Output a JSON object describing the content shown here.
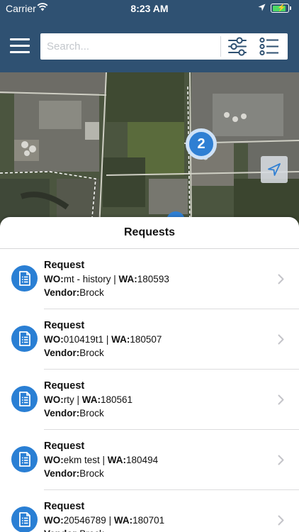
{
  "status_bar": {
    "carrier": "Carrier",
    "time": "8:23 AM",
    "battery_level": 0.9
  },
  "toolbar": {
    "search_placeholder": "Search...",
    "menu_icon": "hamburger-menu-icon",
    "filter_icon": "filter-sliders-icon",
    "list_icon": "list-view-icon"
  },
  "map": {
    "cluster_count": "2",
    "locate_icon": "navigation-arrow-icon",
    "add_icon": "add-location-pin-icon"
  },
  "sheet": {
    "title": "Requests"
  },
  "requests": [
    {
      "title": "Request",
      "wo_label": "WO:",
      "wo": "mt - history",
      "sep": " | ",
      "wa_label": "WA:",
      "wa": "180593",
      "vendor_label": "Vendor:",
      "vendor": "Brock"
    },
    {
      "title": "Request",
      "wo_label": "WO:",
      "wo": "010419t1",
      "sep": " | ",
      "wa_label": "WA:",
      "wa": "180507",
      "vendor_label": "Vendor:",
      "vendor": "Brock"
    },
    {
      "title": "Request",
      "wo_label": "WO:",
      "wo": "rty",
      "sep": " | ",
      "wa_label": "WA:",
      "wa": "180561",
      "vendor_label": "Vendor:",
      "vendor": "Brock"
    },
    {
      "title": "Request",
      "wo_label": "WO:",
      "wo": "ekm test",
      "sep": " | ",
      "wa_label": "WA:",
      "wa": "180494",
      "vendor_label": "Vendor:",
      "vendor": "Brock"
    },
    {
      "title": "Request",
      "wo_label": "WO:",
      "wo": "20546789",
      "sep": " | ",
      "wa_label": "WA:",
      "wa": "180701",
      "vendor_label": "Vendor:",
      "vendor": "Brock"
    }
  ],
  "colors": {
    "header": "#2f5172",
    "accent_blue": "#2a7fd4",
    "battery_green": "#4cd964"
  }
}
